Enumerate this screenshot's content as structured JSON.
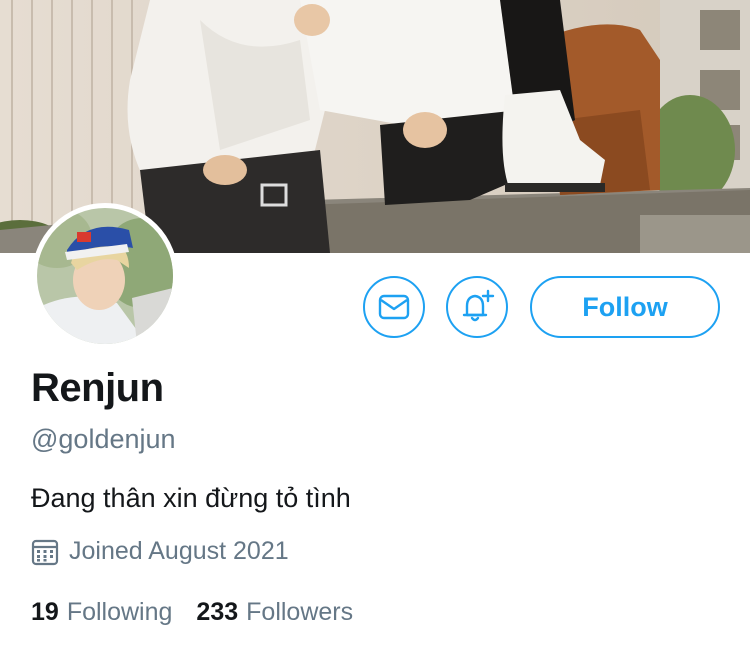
{
  "profile": {
    "name": "Renjun",
    "handle": "@goldenjun",
    "bio": "Đang thân xin đừng tỏ tình",
    "joined": "Joined August 2021"
  },
  "actions": {
    "follow_label": "Follow"
  },
  "stats": {
    "following_count": "19",
    "following_label": "Following",
    "followers_count": "233",
    "followers_label": "Followers"
  },
  "icons": {
    "message": "envelope-icon",
    "notify": "bell-plus-icon",
    "joined": "calendar-icon"
  },
  "colors": {
    "accent": "#1da1f2",
    "text_primary": "#14171a",
    "text_secondary": "#657786"
  }
}
